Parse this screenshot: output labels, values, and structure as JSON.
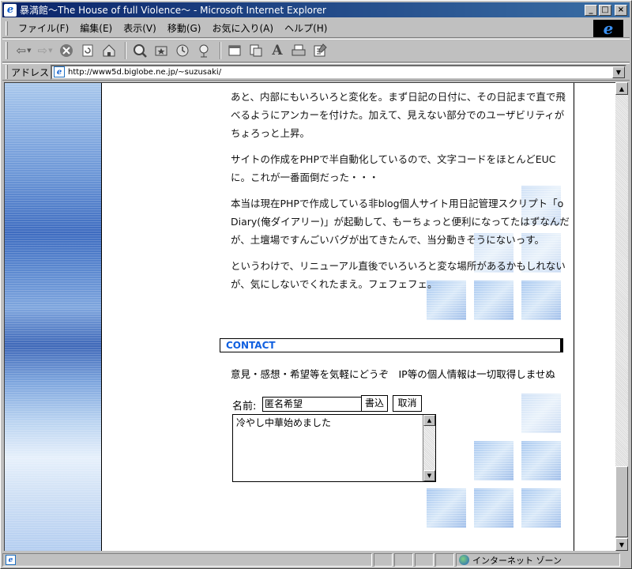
{
  "window": {
    "title": "暴満館〜The House of full Violence〜 - Microsoft Internet Explorer",
    "minimize_glyph": "_",
    "maximize_glyph": "□",
    "close_glyph": "×"
  },
  "menu": {
    "items": [
      "ファイル(F)",
      "編集(E)",
      "表示(V)",
      "移動(G)",
      "お気に入り(A)",
      "ヘルプ(H)"
    ]
  },
  "toolbar": {
    "icons": [
      "back-arrow-icon",
      "forward-arrow-icon",
      "stop-icon",
      "refresh-icon",
      "home-icon",
      "search-icon",
      "favorites-icon",
      "history-icon",
      "channels-icon",
      "fullscreen-icon",
      "mail-icon",
      "font-icon",
      "print-icon",
      "edit-icon"
    ]
  },
  "address": {
    "label": "アドレス",
    "url": "http://www5d.biglobe.ne.jp/~suzusaki/"
  },
  "content": {
    "paragraphs": [
      "あと、内部にもいろいろと変化を。まず日記の日付に、その日記まで直で飛べるようにアンカーを付けた。加えて、見えない部分でのユーザビリティがちょろっと上昇。",
      "サイトの作成をPHPで半自動化しているので、文字コードをほとんどEUCに。これが一番面倒だった・・・",
      "本当は現在PHPで作成している非blog個人サイト用日記管理スクリプト「oDiary(俺ダイアリー)」が起動して、もーちょっと便利になってたはずなんだが、土壇場ですんごいバグが出てきたんで、当分動きそうにないっす。",
      "というわけで、リニューアル直後でいろいろと変な場所があるかもしれないが、気にしないでくれたまえ。フェフェフェ。"
    ]
  },
  "contact": {
    "heading": "CONTACT",
    "description": "意見・感想・希望等を気軽にどうぞ　IP等の個人情報は一切取得しませぬ",
    "name_label": "名前:",
    "name_value": "匿名希望",
    "submit_label": "書込",
    "cancel_label": "取消",
    "message_value": "冷やし中華始めました"
  },
  "status": {
    "zone": "インターネット ゾーン"
  },
  "colors": {
    "title_gradient_start": "#0a246a",
    "contact_heading": "#1060e0"
  }
}
